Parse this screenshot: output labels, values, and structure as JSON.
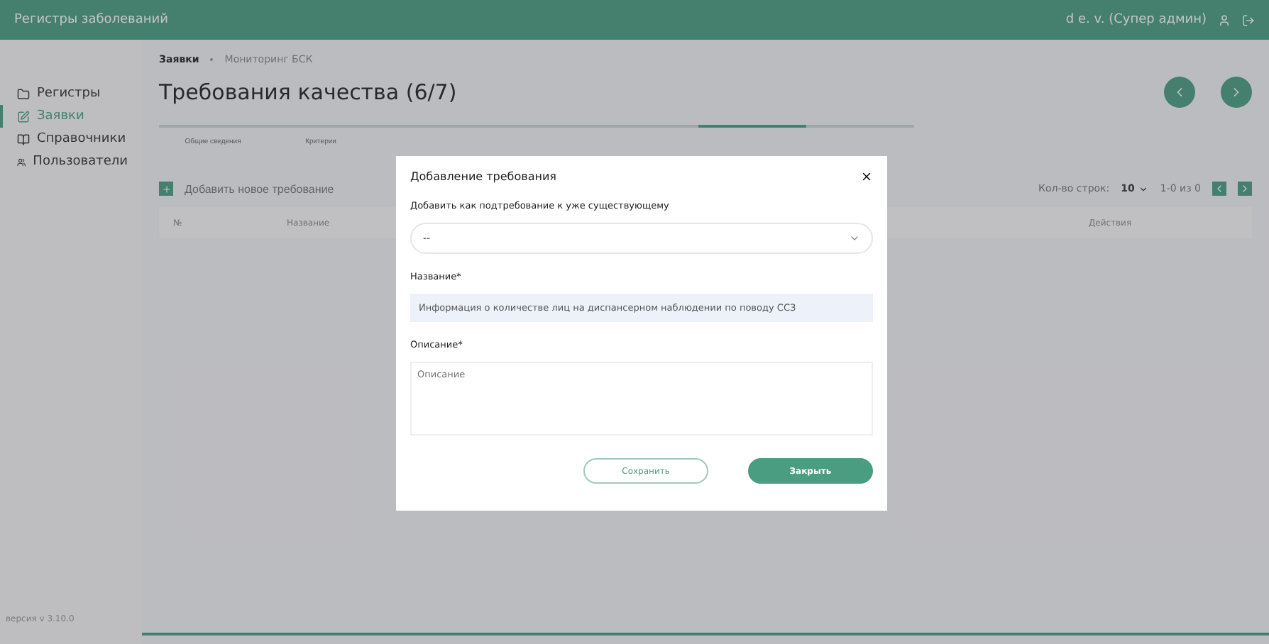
{
  "header": {
    "title": "Регистры заболеваний",
    "user": "d e. v. (Супер админ)"
  },
  "sidebar": {
    "items": [
      {
        "label": "Регистры",
        "selected": false
      },
      {
        "label": "Заявки",
        "selected": true
      },
      {
        "label": "Справочники",
        "selected": false
      },
      {
        "label": "Пользователи",
        "selected": false
      }
    ],
    "version": "версия v 3.10.0"
  },
  "breadcrumbs": [
    "Заявки",
    "Мониторинг БСК"
  ],
  "page_title": "Требования качества (6/7)",
  "tabs": [
    {
      "label": "Общие сведения",
      "selected": false
    },
    {
      "label": "Критерии",
      "selected": false
    },
    {
      "selected": false
    },
    {
      "selected": false
    },
    {
      "selected": false
    },
    {
      "selected": true
    },
    {
      "selected": false
    }
  ],
  "add_button": "Добавить новое требование",
  "rows_per_page": {
    "label": "Кол-во строк:",
    "value": "10"
  },
  "pagination": "1-0 из 0",
  "table": {
    "columns": [
      "№",
      "Название",
      "Действия"
    ]
  },
  "modal": {
    "title": "Добавление требования",
    "parent_label": "Добавить как подтребование к уже существующему",
    "parent_value": "--",
    "name_label": "Название*",
    "name_value": "Информация о количестве лиц на диспансерном наблюдении по поводу ССЗ",
    "description_label": "Описание*",
    "description_placeholder": "Описание",
    "buttons": [
      {
        "label": "Сохранить",
        "kind": "outline"
      },
      {
        "label": "Закрыть",
        "kind": "primary"
      }
    ]
  }
}
